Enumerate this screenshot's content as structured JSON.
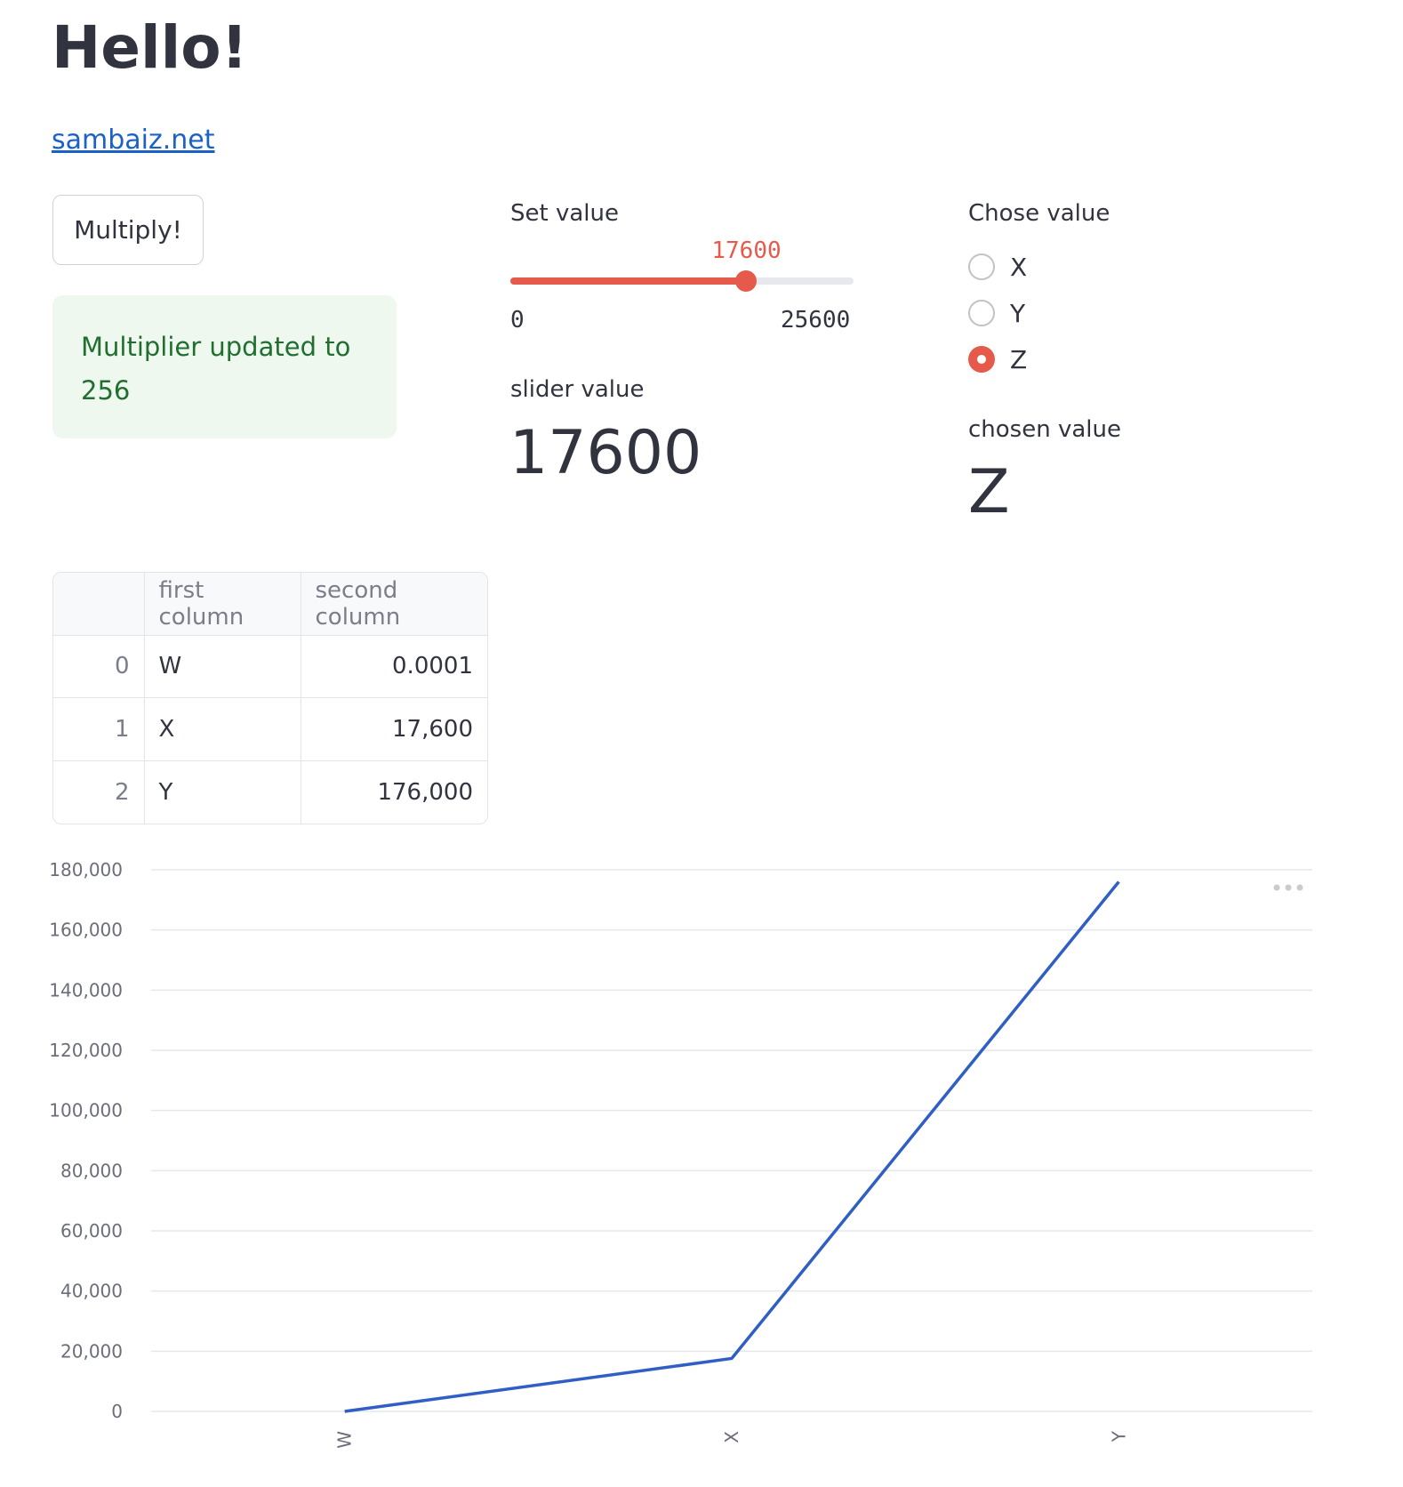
{
  "title": "Hello!",
  "link": {
    "text": "sambaiz.net"
  },
  "button": {
    "label": "Multiply!"
  },
  "alert": {
    "text": "Multiplier updated to 256"
  },
  "slider": {
    "label": "Set value",
    "value": 17600,
    "value_text": "17600",
    "min": 0,
    "max": 25600,
    "min_text": "0",
    "max_text": "25600",
    "accent": "#e55a4b"
  },
  "slider_metric": {
    "label": "slider value",
    "value": "17600"
  },
  "radio": {
    "label": "Chose value",
    "options": [
      {
        "label": "X",
        "checked": false
      },
      {
        "label": "Y",
        "checked": false
      },
      {
        "label": "Z",
        "checked": true
      }
    ]
  },
  "radio_metric": {
    "label": "chosen value",
    "value": "Z"
  },
  "table": {
    "columns": [
      "",
      "first column",
      "second column"
    ],
    "rows": [
      {
        "index": "0",
        "first": "W",
        "second": "0.0001"
      },
      {
        "index": "1",
        "first": "X",
        "second": "17,600"
      },
      {
        "index": "2",
        "first": "Y",
        "second": "176,000"
      }
    ]
  },
  "chart_data": {
    "type": "line",
    "categories": [
      "W",
      "X",
      "Y"
    ],
    "series": [
      {
        "values": [
          0.0001,
          17600,
          176000
        ],
        "color": "#2f5ec4"
      }
    ],
    "yticks": [
      0,
      20000,
      40000,
      60000,
      80000,
      100000,
      120000,
      140000,
      160000,
      180000
    ],
    "ytick_labels": [
      "0",
      "20,000",
      "40,000",
      "60,000",
      "80,000",
      "100,000",
      "120,000",
      "140,000",
      "160,000",
      "180,000"
    ],
    "ylim": [
      0,
      180000
    ],
    "grid": true,
    "menu_icon": "more-horizontal-icon"
  }
}
